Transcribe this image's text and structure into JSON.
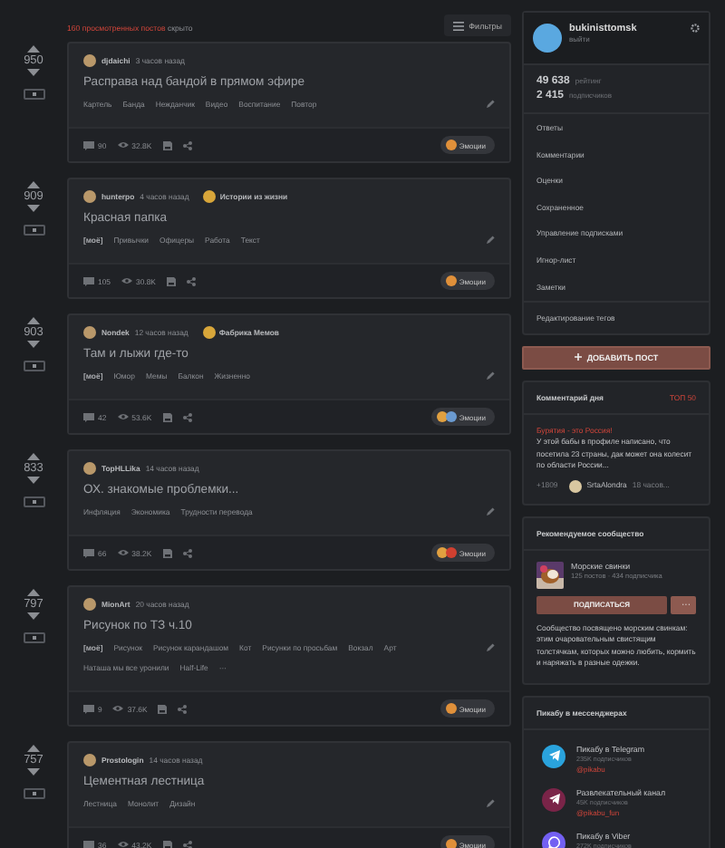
{
  "feed_header": {
    "hidden_count": "160 просмотренных постов",
    "hidden_suffix": "скрыто",
    "filters": "Фильтры"
  },
  "posts": [
    {
      "vote": "950",
      "author": "djdaichi",
      "time": "3 часов назад",
      "title": "Расправа над бандой в прямом эфире",
      "tags": [
        "Картель",
        "Банда",
        "Нежданчик",
        "Видео",
        "Воспитание",
        "Повтор"
      ],
      "comments": "90",
      "views": "32.8K",
      "emotions": "Эмоции",
      "reactions": [
        {
          "color": "#e0903a"
        }
      ]
    },
    {
      "vote": "909",
      "author": "hunterpo",
      "time": "4 часов назад",
      "community": "Истории из жизни",
      "mine": "[моё]",
      "title": "Красная папка",
      "tags": [
        "Привычки",
        "Офицеры",
        "Работа",
        "Текст"
      ],
      "comments": "105",
      "views": "30.8K",
      "emotions": "Эмоции",
      "reactions": [
        {
          "color": "#e0903a"
        }
      ]
    },
    {
      "vote": "903",
      "author": "Nondek",
      "time": "12 часов назад",
      "community": "Фабрика Мемов",
      "mine": "[моё]",
      "title": "Там и лыжи где-то",
      "tags": [
        "Юмор",
        "Мемы",
        "Балкон",
        "Жизненно"
      ],
      "comments": "42",
      "views": "53.6K",
      "emotions": "Эмоции",
      "reactions": [
        {
          "color": "#e0a040"
        },
        {
          "color": "#6a9ad0"
        }
      ]
    },
    {
      "vote": "833",
      "author": "TopHLLika",
      "time": "14 часов назад",
      "title": "ОХ. знакомые проблемки...",
      "tags": [
        "Инфляция",
        "Экономика",
        "Трудности перевода"
      ],
      "comments": "66",
      "views": "38.2K",
      "emotions": "Эмоции",
      "reactions": [
        {
          "color": "#e0a040"
        },
        {
          "color": "#d04030"
        }
      ]
    },
    {
      "vote": "797",
      "author": "MionArt",
      "time": "20 часов назад",
      "mine": "[моё]",
      "title": "Рисунок по ТЗ ч.10",
      "tags": [
        "Рисунок",
        "Рисунок карандашом",
        "Кот",
        "Рисунки по просьбам",
        "Вокзал",
        "Арт",
        "Наташа мы все уронили",
        "Half-Life"
      ],
      "more": "···",
      "comments": "9",
      "views": "37.6K",
      "emotions": "Эмоции",
      "reactions": [
        {
          "color": "#e0903a"
        }
      ]
    },
    {
      "vote": "757",
      "author": "Prostologin",
      "time": "14 часов назад",
      "title": "Цементная лестница",
      "tags": [
        "Лестница",
        "Монолит",
        "Дизайн"
      ],
      "comments": "36",
      "views": "43.2K",
      "emotions": "Эмоции",
      "reactions": [
        {
          "color": "#e0903a"
        }
      ]
    }
  ],
  "profile": {
    "username": "bukinisttomsk",
    "logout": "выйти",
    "stats": [
      {
        "value": "49 638",
        "label": "рейтинг"
      },
      {
        "value": "2 415",
        "label": "подписчиков"
      }
    ],
    "menu": [
      "Ответы",
      "Комментарии",
      "Оценки",
      "Сохраненное",
      "Управление подписками",
      "Игнор-лист",
      "Заметки"
    ],
    "edit_tags": "Редактирование тегов"
  },
  "add_post": "ДОБАВИТЬ ПОСТ",
  "comment_of_day": {
    "title": "Комментарий дня",
    "badge": "ТОП 50",
    "heading": "Бурятия - это Россия!",
    "text": "У этой бабы в профиле написано, что посетила 23 страны, дак может она колесит по области России...",
    "rating": "+1809",
    "author": "SrtaAlondra",
    "time": "18 часов..."
  },
  "community": {
    "title": "Рекомендуемое сообщество",
    "name": "Морские свинки",
    "meta": "125 постов · 434 подписчика",
    "subscribe": "ПОДПИСАТЬСЯ",
    "more": "···",
    "description": "Сообщество посвящено морским свинкам: этим очаровательным свистящим толстячкам, которых можно любить, кормить и наряжать в разные одежки."
  },
  "messengers": {
    "title": "Пикабу в мессенджерах",
    "items": [
      {
        "kind": "telegram",
        "color": "#2aa3dd",
        "name": "Пикабу в Telegram",
        "subs": "235K подписчиков",
        "handle": "@pikabu"
      },
      {
        "kind": "telegram",
        "color": "#7a2448",
        "name": "Развлекательный канал",
        "subs": "45K подписчиков",
        "handle": "@pikabu_fun"
      },
      {
        "kind": "viber",
        "color": "#7360f2",
        "name": "Пикабу в Viber",
        "subs": "272K подписчиков"
      }
    ]
  }
}
